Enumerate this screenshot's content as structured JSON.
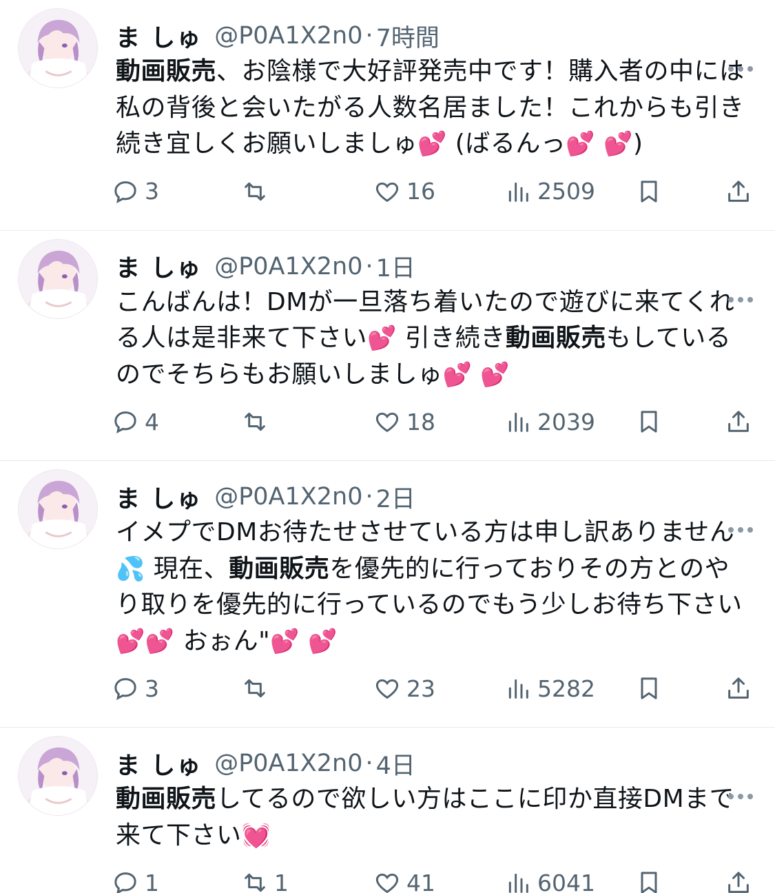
{
  "tweets": [
    {
      "name": "ま しゅ",
      "handle": "@P0A1X2n0",
      "time": "7時間",
      "segments": [
        {
          "bold": "動画販売"
        },
        {
          "text": "、お陰様で大好評発売中です！購入者の中には私の背後と会いたがる人数名居ました！これからも引き続き宜しくお願いしましゅ"
        },
        {
          "heart": "💕"
        },
        {
          "text": " (ばるんっ"
        },
        {
          "heart": "💕"
        },
        {
          "text": " "
        },
        {
          "heart": "💕"
        },
        {
          "text": ")"
        }
      ],
      "replies": "3",
      "retweets": "",
      "likes": "16",
      "views": "2509"
    },
    {
      "name": "ま しゅ",
      "handle": "@P0A1X2n0",
      "time": "1日",
      "segments": [
        {
          "text": "こんばんは！DMが一旦落ち着いたので遊びに来てくれる人は是非来て下さい"
        },
        {
          "heart": "💕"
        },
        {
          "text": " 引き続き"
        },
        {
          "bold": "動画販売"
        },
        {
          "text": "もしているのでそちらもお願いしましゅ"
        },
        {
          "heart": "💕"
        },
        {
          "text": " "
        },
        {
          "heart": "💕"
        }
      ],
      "replies": "4",
      "retweets": "",
      "likes": "18",
      "views": "2039"
    },
    {
      "name": "ま しゅ",
      "handle": "@P0A1X2n0",
      "time": "2日",
      "segments": [
        {
          "text": "イメプでDMお待たせさせている方は申し訳ありません"
        },
        {
          "sweat": "💦"
        },
        {
          "text": " 現在、"
        },
        {
          "bold": "動画販売"
        },
        {
          "text": "を優先的に行っておりその方とのやり取りを優先的に行っているのでもう少しお待ち下さい"
        },
        {
          "heart": "💕"
        },
        {
          "heart": "💕"
        },
        {
          "text": " おぉん\""
        },
        {
          "heart": "💕"
        },
        {
          "text": " "
        },
        {
          "heart": "💕"
        }
      ],
      "replies": "3",
      "retweets": "",
      "likes": "23",
      "views": "5282"
    },
    {
      "name": "ま しゅ",
      "handle": "@P0A1X2n0",
      "time": "4日",
      "segments": [
        {
          "bold": "動画販売"
        },
        {
          "text": "してるので欲しい方はここに印か直接DMまで来て下さい"
        },
        {
          "heart": "💓"
        }
      ],
      "replies": "1",
      "retweets": "1",
      "likes": "41",
      "views": "6041"
    }
  ],
  "colors": {
    "text": "#0f1419",
    "secondary": "#536471",
    "divider": "#e6e9ec",
    "heart_emoji": "#ff3aa7",
    "sweat_emoji": "#35a3e8"
  },
  "icons": [
    "more-icon",
    "reply-icon",
    "retweet-icon",
    "like-icon",
    "views-icon",
    "bookmark-icon",
    "share-icon"
  ]
}
